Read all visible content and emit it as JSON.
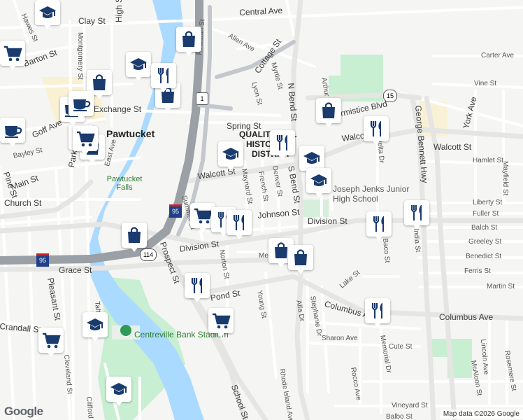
{
  "map": {
    "place_labels": [
      {
        "text": "Pawtucket",
        "kind": "place"
      },
      {
        "text": "QUALITY HILL",
        "kind": "district"
      },
      {
        "text": "HISTORIC",
        "kind": "district"
      },
      {
        "text": "DISTRICT",
        "kind": "district"
      },
      {
        "text": "Pawtucket Falls",
        "kind": "poi"
      },
      {
        "text": "Joseph Jenks Junior High School",
        "kind": "poi"
      },
      {
        "text": "Centreville Bank Stadium",
        "kind": "poi"
      }
    ],
    "street_labels": [
      "Clay St",
      "Central Ave",
      "Allen Ave",
      "Carter Ave",
      "Barton St",
      "Hawes St",
      "Montgomery St",
      "High St",
      "Cottage St",
      "Vine St",
      "Fountain St",
      "Exchange St",
      "Myrtle St",
      "Lyon St",
      "Arthur St",
      "N Bend St",
      "Armistice Blvd",
      "George Bennett Hwy",
      "York Ave",
      "Spring St",
      "Goff Ave",
      "Bayley St",
      "Walcott St",
      "Delta Dr",
      "Hamlet St",
      "Mayfield St",
      "Pine St",
      "Main St",
      "Park Pl",
      "East Ave",
      "Maynard St",
      "French St",
      "Denver St",
      "S Bend St",
      "Church St",
      "Liberty St",
      "Summer St",
      "Johnson St",
      "Division St",
      "Fuller St",
      "Balch St",
      "Greeley St",
      "Benedict St",
      "Ferris St",
      "Grace St",
      "Prospect St",
      "Norton St",
      "Meeker St",
      "Lake St",
      "Martin St",
      "Pleasant St",
      "Pond St",
      "Young St",
      "Alfa Dr",
      "Stephanie Dr",
      "Columbus Ave",
      "Crandall St",
      "Sharon Ave",
      "Cute St",
      "Memorial Dr",
      "Lincoln Ave",
      "Rocco Ave",
      "McAloon St",
      "Rosemere St",
      "Cleveland St",
      "School St",
      "Rhode Island Ave",
      "Vineyard St",
      "Clifford St",
      "Balbo St",
      "Baco St",
      "India St",
      "Taft St"
    ],
    "route_shields": [
      "1",
      "15",
      "95",
      "114"
    ],
    "markers": [
      {
        "type": "school",
        "icon": "mortarboard-icon"
      },
      {
        "type": "shopping",
        "icon": "shopping-bag-icon"
      },
      {
        "type": "shopping-cart",
        "icon": "shopping-cart-icon"
      },
      {
        "type": "restaurant",
        "icon": "fork-knife-icon"
      },
      {
        "type": "cafe",
        "icon": "coffee-cup-icon"
      }
    ],
    "stadium_icon": "stadium-icon",
    "colors": {
      "water": "#aadaff",
      "park": "#c8efd1",
      "highway": "#9aa0a6",
      "road": "#ffffff",
      "marker_icon": "#1a3b6e"
    }
  },
  "footer": {
    "logo": "Google",
    "attribution": "Map data ©2026 Google"
  }
}
